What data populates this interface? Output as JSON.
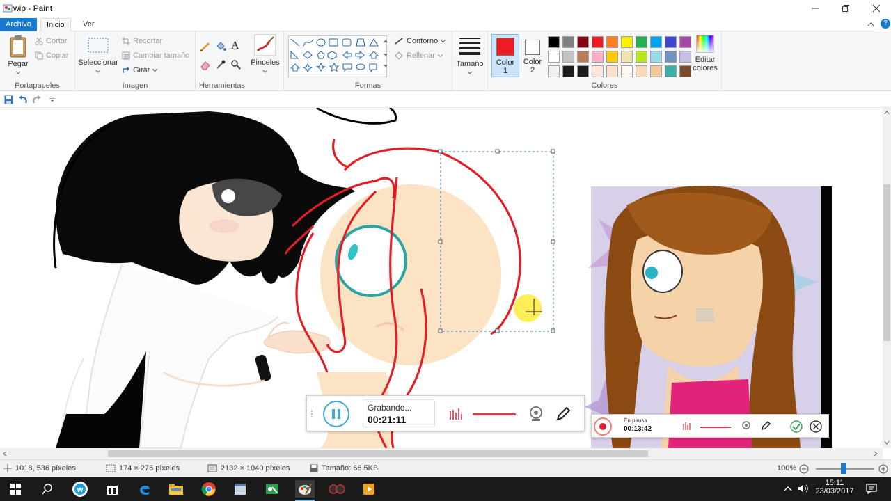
{
  "window": {
    "title": "wip - Paint"
  },
  "menu": {
    "file": "Archivo",
    "home": "Inicio",
    "view": "Ver"
  },
  "clipboard": {
    "paste": "Pegar",
    "cut": "Cortar",
    "copy": "Copiar",
    "label": "Portapapeles"
  },
  "image": {
    "select": "Seleccionar",
    "crop": "Recortar",
    "resize": "Cambiar tamaño",
    "rotate": "Girar",
    "label": "Imagen"
  },
  "tools": {
    "label": "Herramientas",
    "brushes": "Pinceles"
  },
  "shapes": {
    "outline": "Contorno",
    "fill": "Rellenar",
    "label": "Formas"
  },
  "size": {
    "label": "Tamaño"
  },
  "colors": {
    "color1_label": "Color",
    "color1_num": "1",
    "color2_label": "Color",
    "color2_num": "2",
    "edit": "Editar colores",
    "label": "Colores",
    "color1": "#ed1c24",
    "color2": "#ffffff",
    "palette_row1": [
      "#000000",
      "#7f7f7f",
      "#880015",
      "#ed1c24",
      "#ff7f27",
      "#fff200",
      "#22b14c",
      "#00a2e8",
      "#3f48cc",
      "#a349a4"
    ],
    "palette_row2": [
      "#ffffff",
      "#c3c3c3",
      "#b97a57",
      "#ffaec9",
      "#ffc90e",
      "#efe4b0",
      "#b5e61d",
      "#99d9ea",
      "#7092be",
      "#c8bfe7"
    ],
    "palette_row3": [
      "#f0f0f0",
      "#1c1c1c",
      "#1c1c1c",
      "#fce4d6",
      "#fde0cc",
      "#fff8f0",
      "#f7d9b5",
      "#f0c89a",
      "#3aafa9",
      "#7a4a2a"
    ]
  },
  "recorder_main": {
    "status": "Grabando...",
    "time": "00:21:11"
  },
  "recorder_small": {
    "status": "En pausa",
    "time": "00:13:42"
  },
  "status": {
    "cursor": "1018, 536 píxeles",
    "selection": "174 × 276 píxeles",
    "canvas": "2132 × 1040 píxeles",
    "filesize": "Tamaño: 66.5KB",
    "zoom": "100%"
  },
  "taskbar": {
    "time": "15:11",
    "date": "23/03/2017"
  }
}
